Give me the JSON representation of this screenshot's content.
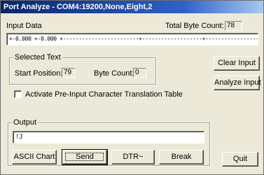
{
  "window": {
    "title": "Port Analyze - COM4:19200,None,Eight,2"
  },
  "input_data": {
    "label": "Input Data",
    "total_byte_count_label": "Total Byte Count:",
    "total_byte_count": "78",
    "value": "+-0.000 +-0.000 +------------------------+-------------------+-------------------→"
  },
  "selected_text": {
    "title": "Selected Text",
    "start_position_label": "Start Position:",
    "start_position": "79",
    "byte_count_label": "Byte Count:",
    "byte_count": "0"
  },
  "buttons": {
    "clear_input": "Clear Input",
    "analyze_input": "Analyze Input",
    "ascii_chart": "ASCII Chart",
    "send": "Send",
    "dtr": "DTR~",
    "break": "Break",
    "quit": "Quit"
  },
  "checkbox": {
    "label": "Activate Pre-Input Character Translation Table",
    "checked": false
  },
  "output": {
    "title": "Output",
    "value": "!J"
  }
}
